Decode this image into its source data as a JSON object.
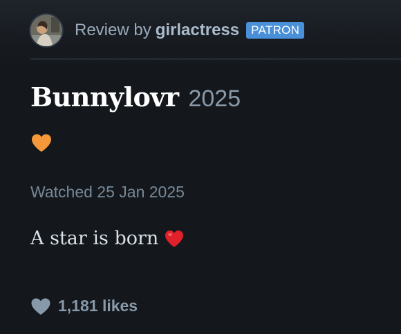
{
  "review_header": {
    "prefix": "Review by",
    "username": "girlactress",
    "badge": "PATRON"
  },
  "film": {
    "title": "Bunnylovr",
    "year": "2025",
    "liked": true,
    "liked_heart_color": "#f5983a"
  },
  "watched": "Watched 25 Jan 2025",
  "review": {
    "text": "A star is born",
    "emoji": "red-heart-icon"
  },
  "likes": {
    "count": "1,181 likes",
    "icon": "heart-icon"
  },
  "colors": {
    "background": "#14181c",
    "badge": "#4a90d9",
    "accent_heart": "#f5983a",
    "emoji_heart": "#e0202a"
  }
}
